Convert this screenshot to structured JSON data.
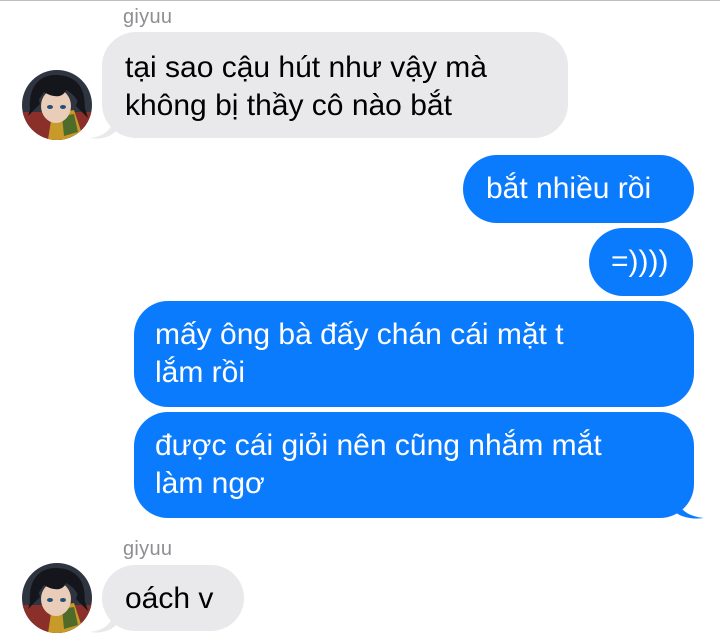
{
  "colors": {
    "outgoing_bubble": "#0b7bfe",
    "incoming_bubble": "#e9e9eb",
    "sender_name": "#8e8e93",
    "background": "#ffffff"
  },
  "messages": [
    {
      "direction": "incoming",
      "sender": "giyuu",
      "avatar_icon": "anime-avatar",
      "lines": [
        "tại sao cậu hút như vậy mà",
        "không bị thầy cô nào bắt"
      ]
    },
    {
      "direction": "outgoing",
      "lines": [
        "bắt nhiều rồi"
      ]
    },
    {
      "direction": "outgoing",
      "lines": [
        "=))))"
      ]
    },
    {
      "direction": "outgoing",
      "lines": [
        "mấy ông bà đấy chán cái mặt t",
        "lắm rồi"
      ]
    },
    {
      "direction": "outgoing",
      "lines": [
        "được cái giỏi nên cũng nhắm mắt",
        "làm ngơ"
      ]
    },
    {
      "direction": "incoming",
      "sender": "giyuu",
      "avatar_icon": "anime-avatar",
      "lines": [
        "oách v"
      ]
    }
  ]
}
